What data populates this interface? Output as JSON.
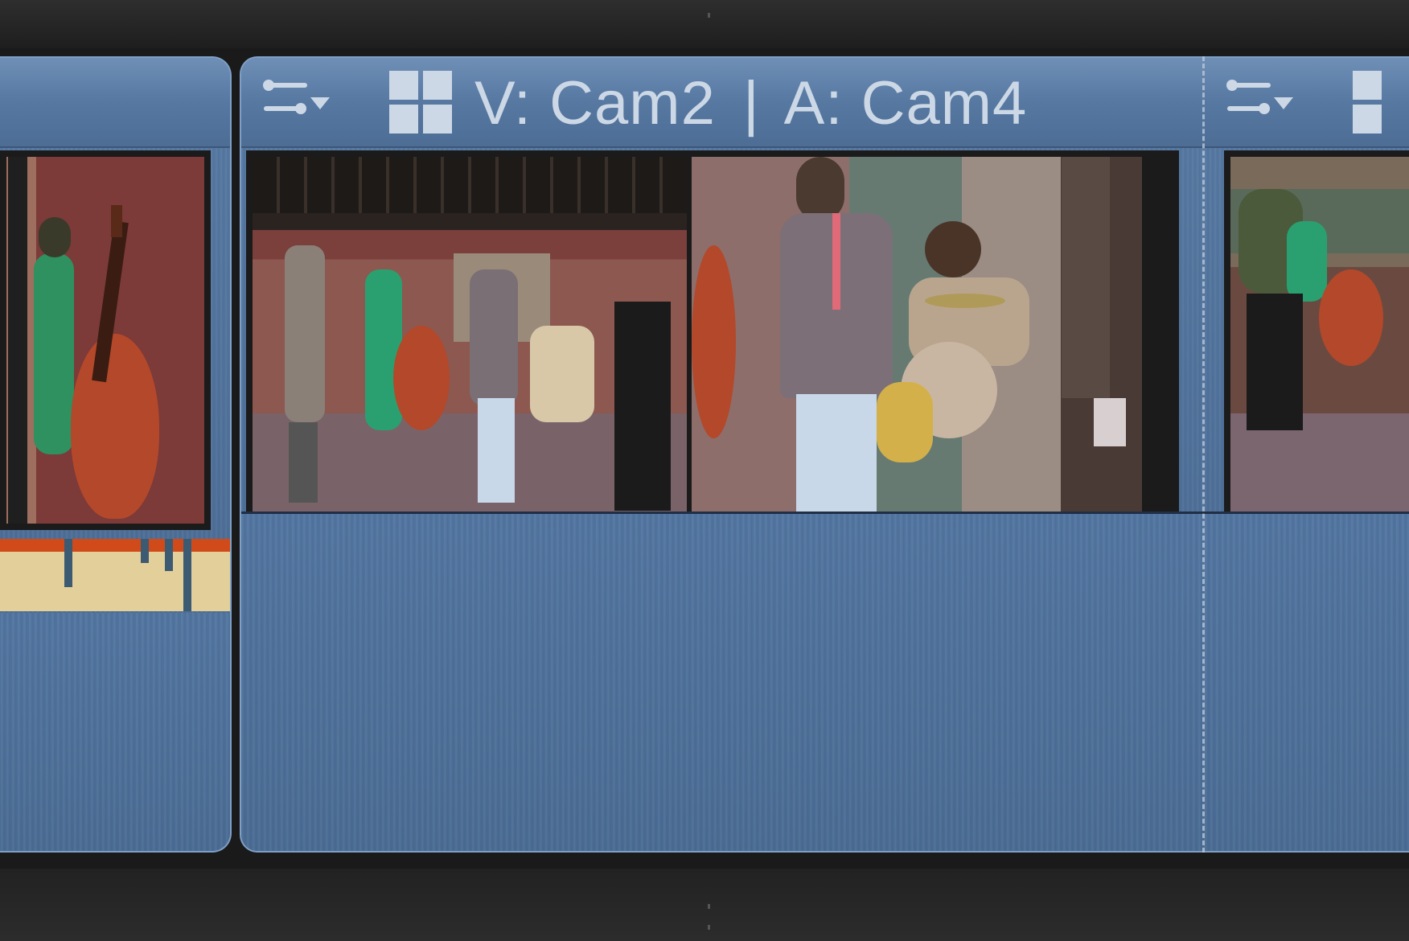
{
  "timeline": {
    "clip": {
      "title_video": "V: Cam2",
      "separator": "|",
      "title_audio": "A: Cam4"
    }
  },
  "colors": {
    "clip_blue": "#577aa3",
    "header_blue": "#6f8fb6",
    "title_text": "#cdd8e6",
    "background": "#262626"
  },
  "icons": [
    "sliders-icon",
    "angle-grid-icon"
  ]
}
